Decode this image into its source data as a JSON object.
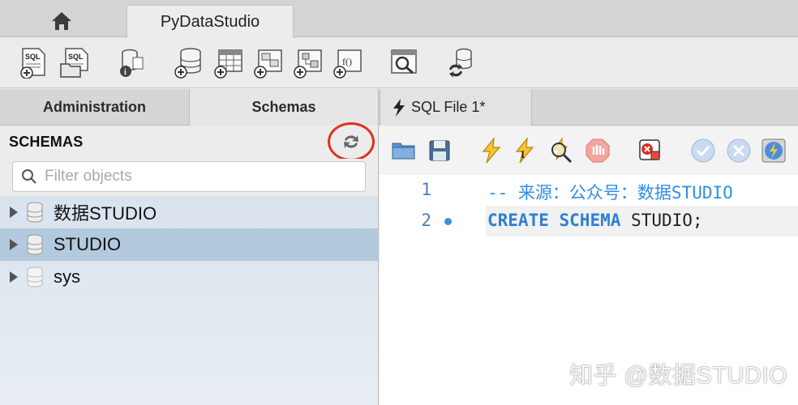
{
  "tabs": {
    "home_icon": "home-icon",
    "connection_label": "PyDataStudio"
  },
  "toolbar_icons": [
    "new-sql-tab-icon",
    "open-sql-script-icon",
    "inspector-icon",
    "create-schema-icon",
    "create-table-icon",
    "create-view-icon",
    "create-procedure-icon",
    "create-function-icon",
    "search-table-data-icon",
    "reconnect-icon"
  ],
  "subtabs": {
    "administration": "Administration",
    "schemas": "Schemas",
    "sql_file": "SQL File 1*"
  },
  "left_panel": {
    "title": "SCHEMAS",
    "filter_placeholder": "Filter objects",
    "schemas": [
      "数据STUDIO",
      "STUDIO",
      "sys"
    ],
    "selected_index": 1
  },
  "editor": {
    "line_numbers": [
      "1",
      "2"
    ],
    "line1": {
      "comment": "-- 来源：公众号：数据STUDIO"
    },
    "line2": {
      "kw1": "CREATE",
      "kw2": "SCHEMA",
      "ident": "STUDIO;"
    }
  },
  "watermark": "知乎 @数据STUDIO",
  "colors": {
    "accent": "#2f7fd2",
    "highlight_circle": "#e0301e",
    "selected_row": "#b3c9dd"
  }
}
